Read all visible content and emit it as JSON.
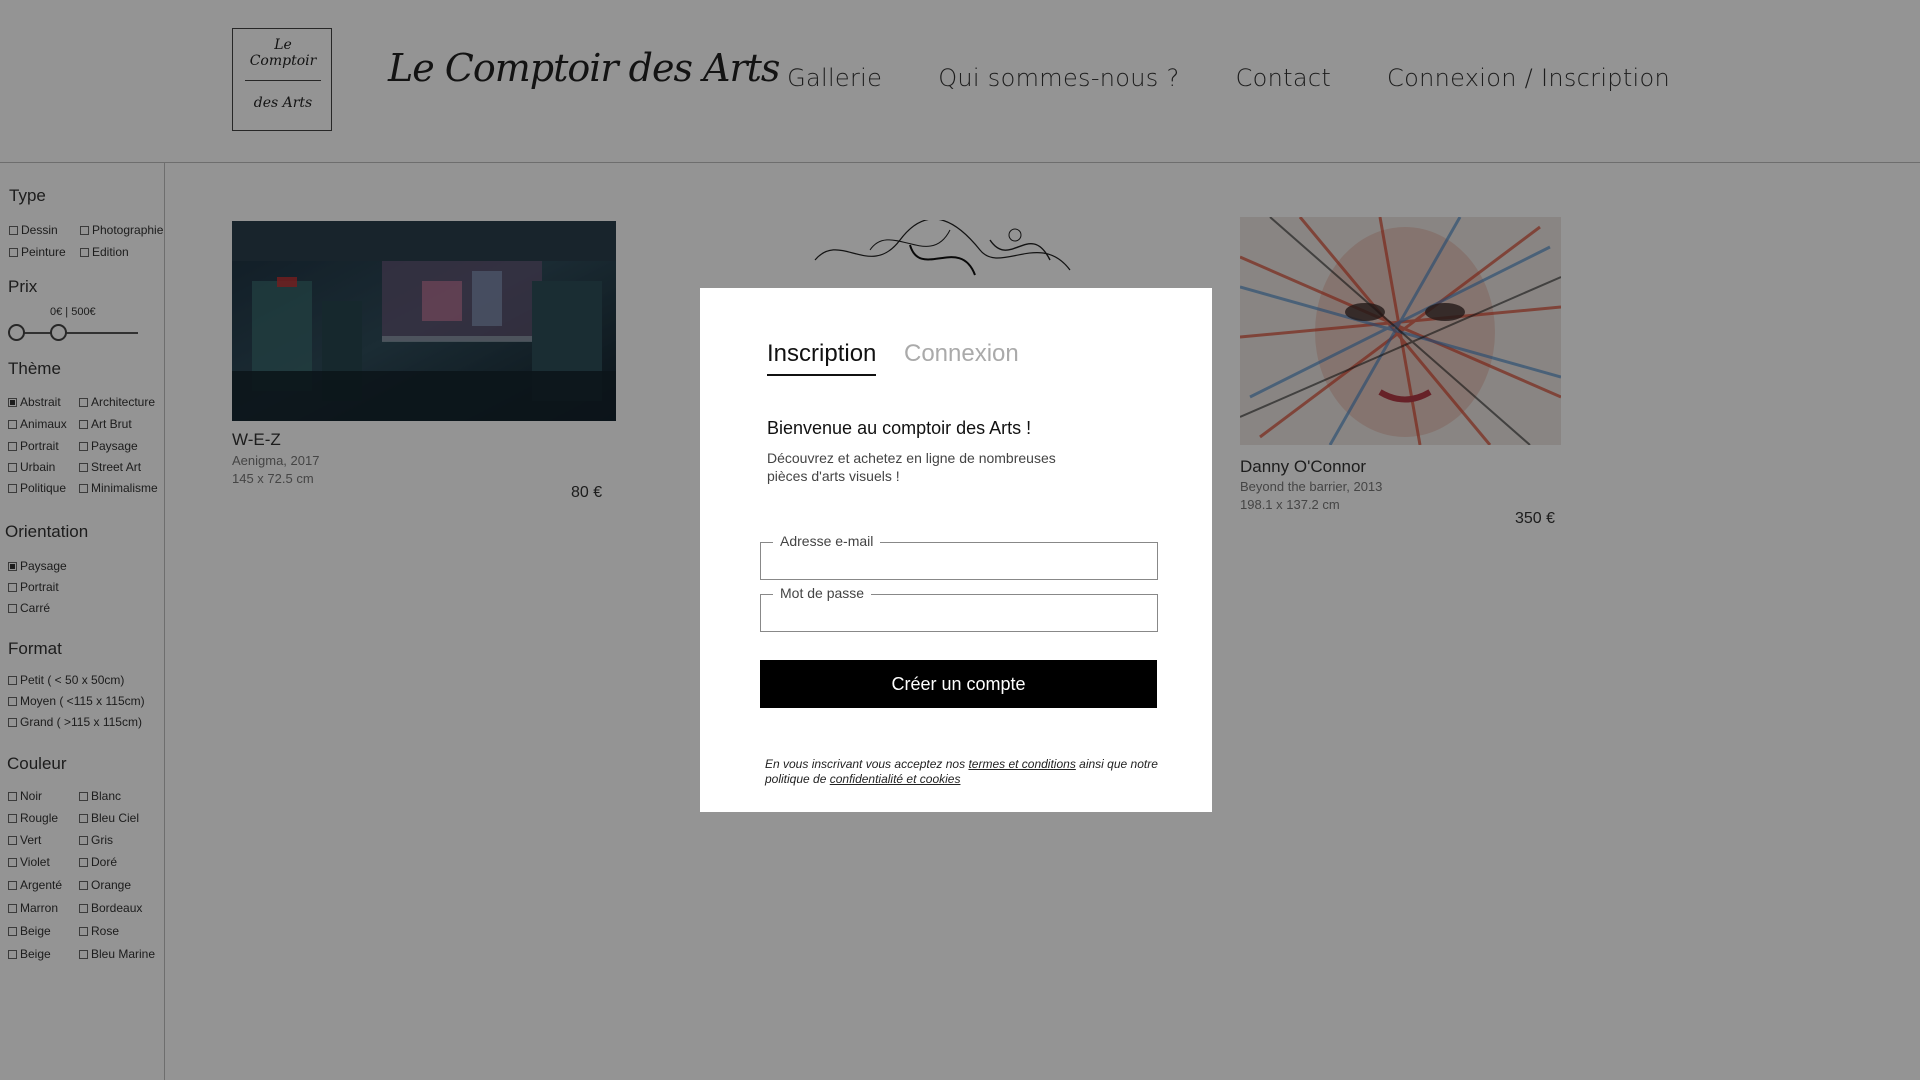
{
  "header": {
    "logo_box_line1": "Le Comptoir",
    "logo_box_line2": "des Arts",
    "logo_script": "Le Comptoir des Arts",
    "nav": [
      "Gallerie",
      "Qui sommes-nous ?",
      "Contact",
      "Connexion / Inscription"
    ]
  },
  "sidebar": {
    "type": {
      "title": "Type",
      "options": [
        {
          "label": "Dessin",
          "checked": false
        },
        {
          "label": "Photographie",
          "checked": false
        },
        {
          "label": "Peinture",
          "checked": false
        },
        {
          "label": "Edition",
          "checked": false
        }
      ]
    },
    "prix": {
      "title": "Prix",
      "range_text": "0€ | 500€",
      "min": 0,
      "max": 500
    },
    "theme": {
      "title": "Thème",
      "options": [
        {
          "label": "Abstrait",
          "checked": true
        },
        {
          "label": "Architecture",
          "checked": false
        },
        {
          "label": "Animaux",
          "checked": false
        },
        {
          "label": "Art Brut",
          "checked": false
        },
        {
          "label": "Portrait",
          "checked": false
        },
        {
          "label": "Paysage",
          "checked": false
        },
        {
          "label": "Urbain",
          "checked": false
        },
        {
          "label": "Street Art",
          "checked": false
        },
        {
          "label": "Politique",
          "checked": false
        },
        {
          "label": "Minimalisme",
          "checked": false
        }
      ]
    },
    "orientation": {
      "title": "Orientation",
      "options": [
        {
          "label": "Paysage",
          "checked": true
        },
        {
          "label": "Portrait",
          "checked": false
        },
        {
          "label": "Carré",
          "checked": false
        }
      ]
    },
    "format": {
      "title": "Format",
      "options": [
        {
          "label": "Petit ( < 50 x 50cm)",
          "checked": false
        },
        {
          "label": "Moyen ( <115 x 115cm)",
          "checked": false
        },
        {
          "label": "Grand ( >115 x 115cm)",
          "checked": false
        }
      ]
    },
    "couleur": {
      "title": "Couleur",
      "options": [
        {
          "label": "Noir",
          "checked": false
        },
        {
          "label": "Blanc",
          "checked": false
        },
        {
          "label": "Rougle",
          "checked": false
        },
        {
          "label": "Bleu Ciel",
          "checked": false
        },
        {
          "label": "Vert",
          "checked": false
        },
        {
          "label": "Gris",
          "checked": false
        },
        {
          "label": "Violet",
          "checked": false
        },
        {
          "label": "Doré",
          "checked": false
        },
        {
          "label": "Argenté",
          "checked": false
        },
        {
          "label": "Orange",
          "checked": false
        },
        {
          "label": "Marron",
          "checked": false
        },
        {
          "label": "Bordeaux",
          "checked": false
        },
        {
          "label": "Beige",
          "checked": false
        },
        {
          "label": "Rose",
          "checked": false
        },
        {
          "label": "Beige",
          "checked": false
        },
        {
          "label": "Bleu Marine",
          "checked": false
        }
      ]
    }
  },
  "artworks": [
    {
      "title": "W-E-Z",
      "subtitle": "Aenigma, 2017",
      "dimensions": "145 x 72.5 cm",
      "price": "80 €"
    },
    {
      "title": "Danny O'Connor",
      "subtitle": "Beyond the barrier, 2013",
      "dimensions": "198.1 x 137.2 cm",
      "price": "350 €"
    }
  ],
  "modal": {
    "tab_active": "Inscription",
    "tab_inactive": "Connexion",
    "welcome": "Bienvenue au comptoir des Arts !",
    "description": "Découvrez et achetez en ligne de nombreuses pièces d'arts visuels !",
    "email_label": "Adresse e-mail",
    "email_value": "",
    "password_label": "Mot de passe",
    "password_value": "",
    "submit_label": "Créer un compte",
    "terms_prefix": "En vous inscrivant vous acceptez nos ",
    "terms_link": "termes et conditions",
    "terms_middle": " ainsi que notre politique de ",
    "privacy_link": "confidentialité et cookies"
  },
  "colors": {
    "overlay": "#000000",
    "overlay_opacity": "0.42",
    "button": "#000000"
  }
}
